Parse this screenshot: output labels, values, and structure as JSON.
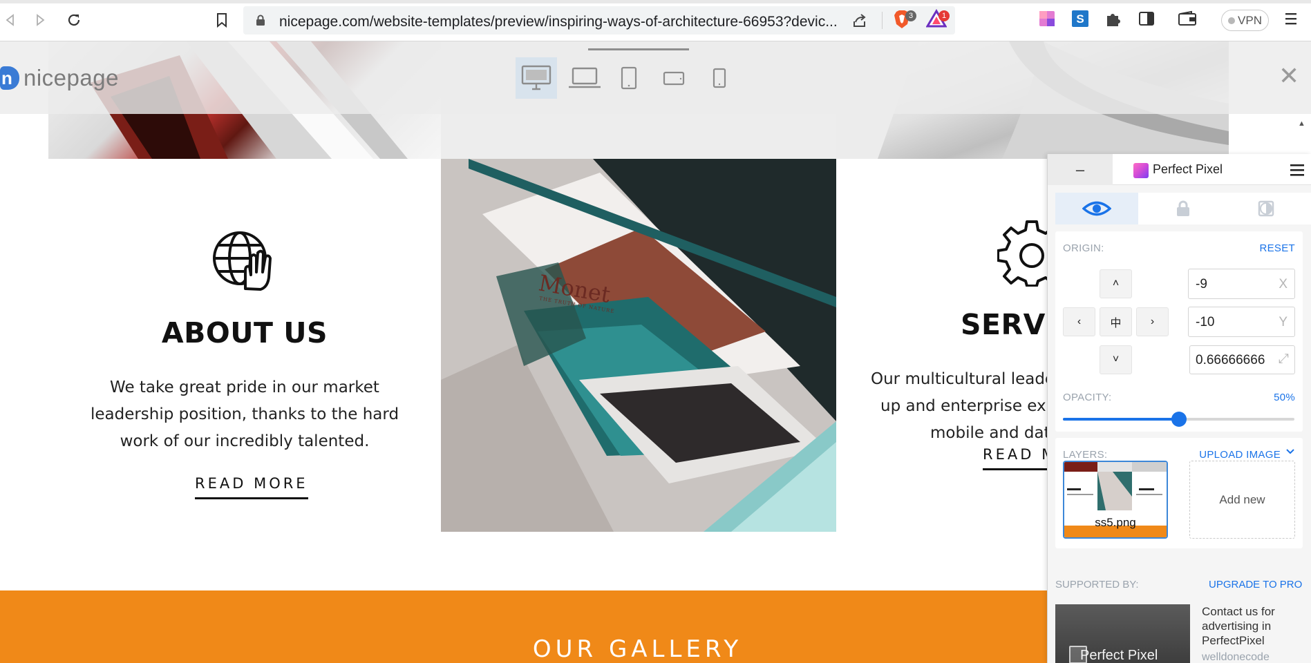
{
  "browser": {
    "url": "nicepage.com/website-templates/preview/inspiring-ways-of-architecture-66953?devic...",
    "extension_badges": {
      "brave": "3",
      "alert": "1"
    },
    "vpn_label": "VPN",
    "icons": [
      "back-icon",
      "forward-icon",
      "reload-icon",
      "bookmark-icon",
      "lock-icon",
      "share-icon",
      "brave-shield-icon",
      "brave-rewards-icon",
      "perfect-pixel-ext-icon",
      "s-ext-icon",
      "puzzle-icon",
      "sidepanel-icon",
      "wallet-icon",
      "menu-icon"
    ]
  },
  "preview_bar": {
    "logo_text": "nicepage",
    "devices": [
      "desktop",
      "laptop",
      "tablet",
      "tablet-landscape",
      "phone"
    ],
    "selected_device": "desktop"
  },
  "page": {
    "about": {
      "title": "ABOUT US",
      "text_lines": [
        "We take great pride in our market",
        "leadership position, thanks to the hard",
        "work of our incredibly talented."
      ],
      "cta": "READ MORE"
    },
    "services": {
      "title": "SERVI",
      "text_lines": [
        "Our multicultural leade",
        "up and enterprise exp",
        "mobile and data"
      ],
      "cta": "READ M"
    },
    "photo_caption": {
      "title": "Monet",
      "subtitle": "THE TRUTH OF NATURE"
    },
    "gallery_title": "OUR GALLERY",
    "accent_color": "#f08918"
  },
  "perfect_pixel": {
    "title": "Perfect Pixel",
    "minimize": "–",
    "origin_label": "ORIGIN:",
    "reset_label": "RESET",
    "center_glyph": "中",
    "x_value": "-9",
    "x_unit": "X",
    "y_value": "-10",
    "y_unit": "Y",
    "scale_value": "0.66666666",
    "opacity_label": "OPACITY:",
    "opacity_text": "50%",
    "opacity_fraction": 0.5,
    "layers_label": "LAYERS:",
    "upload_label": "UPLOAD IMAGE",
    "layer_name": "ss5.png",
    "add_new_label": "Add new",
    "supported_label": "SUPPORTED BY:",
    "upgrade_label": "UPGRADE TO PRO",
    "ad_image_label": "Perfect Pixel",
    "ad_text": "Contact us for advertising in PerfectPixel",
    "ad_domain": "welldonecode",
    "accent_color": "#1a73e8"
  }
}
